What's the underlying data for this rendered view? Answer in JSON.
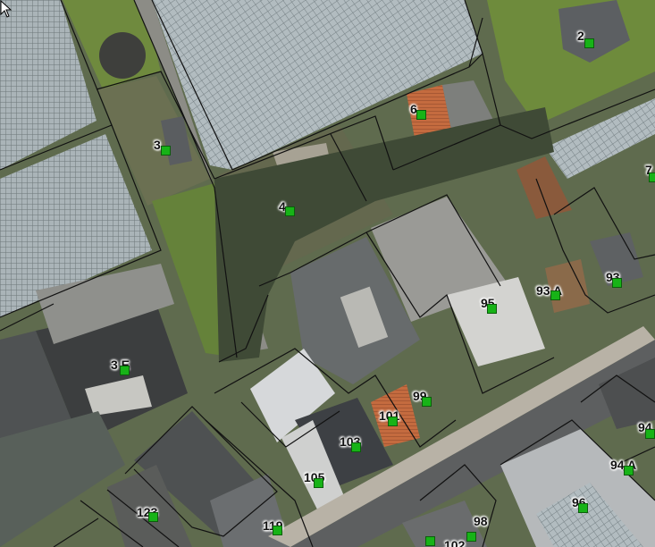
{
  "map": {
    "labels": [
      {
        "id": "2",
        "text": "2"
      },
      {
        "id": "3",
        "text": "3"
      },
      {
        "id": "4",
        "text": "4"
      },
      {
        "id": "6",
        "text": "6"
      },
      {
        "id": "7",
        "text": "7"
      },
      {
        "id": "3e",
        "text": "3 E"
      },
      {
        "id": "93a",
        "text": "93 A"
      },
      {
        "id": "93",
        "text": "93"
      },
      {
        "id": "95",
        "text": "95"
      },
      {
        "id": "99",
        "text": "99"
      },
      {
        "id": "101",
        "text": "101"
      },
      {
        "id": "103",
        "text": "103"
      },
      {
        "id": "105",
        "text": "105"
      },
      {
        "id": "123",
        "text": "123"
      },
      {
        "id": "119",
        "text": "119"
      },
      {
        "id": "98",
        "text": "98"
      },
      {
        "id": "96",
        "text": "96"
      },
      {
        "id": "94",
        "text": "94"
      },
      {
        "id": "94a",
        "text": "94 A"
      },
      {
        "id": "102",
        "text": "102"
      }
    ],
    "colors": {
      "greenhouse": "#aeb8bc",
      "grass": "#6f8a3e",
      "road": "#8c8c86",
      "roof_dark": "#55595a",
      "roof_flat": "#9a9a96",
      "parcel_line": "#111111",
      "marker": "#17b317"
    }
  }
}
